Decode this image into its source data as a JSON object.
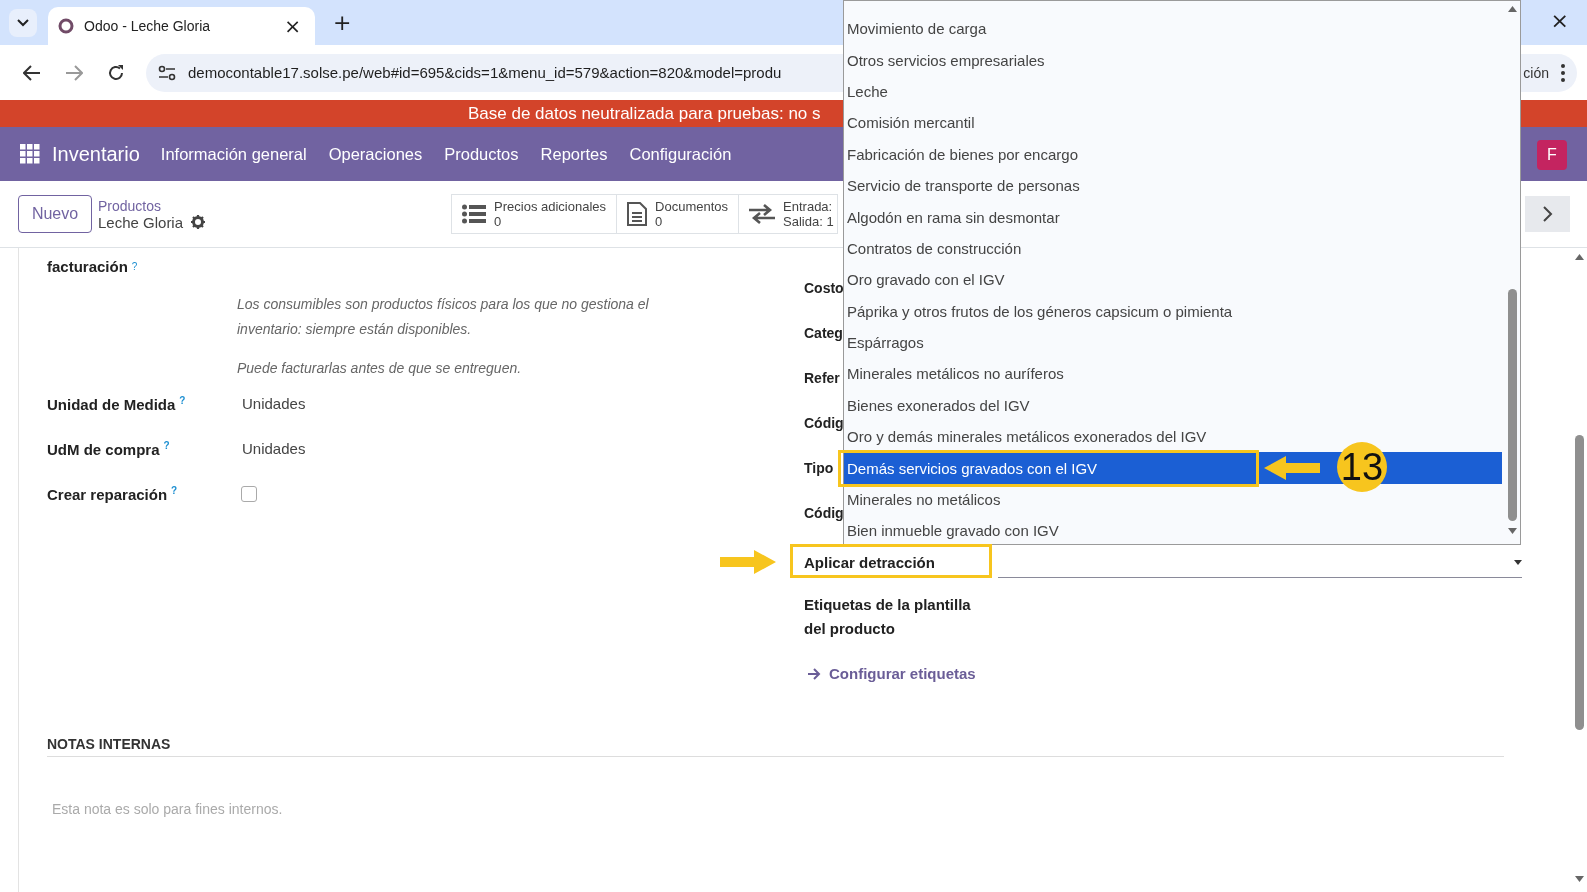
{
  "browser": {
    "tab_title": "Odoo - Leche Gloria",
    "tab_close": "×",
    "new_tab": "+",
    "window_close": "×",
    "url": "democontable17.solse.pe/web#id=695&cids=1&menu_id=579&action=820&model=produ",
    "url_end": "ción"
  },
  "banner": "Base de datos neutralizada para pruebas: no s",
  "navbar": {
    "app": "Inventario",
    "menu": [
      "Información general",
      "Operaciones",
      "Productos",
      "Reportes",
      "Configuración"
    ],
    "avatar": "F"
  },
  "control_panel": {
    "new_button": "Nuevo",
    "breadcrumb_parent": "Productos",
    "record": "Leche Gloria",
    "stat_buttons": [
      {
        "kind": "list",
        "label": "Precios adicionales",
        "value": "0"
      },
      {
        "kind": "document",
        "label": "Documentos",
        "value": "0"
      },
      {
        "kind": "transfer",
        "label": "Entrada:",
        "value": "Salida: 1"
      }
    ]
  },
  "form": {
    "invoicing_label": "facturación",
    "invoicing_help": "?",
    "notes": [
      "Los consumibles son productos físicos para los que no gestiona el inventario: siempre están disponibles.",
      "Puede facturarlas antes de que se entreguen."
    ],
    "left_fields": [
      {
        "kind": "value",
        "label": "Unidad de Medida",
        "help": "?",
        "value": "Unidades"
      },
      {
        "kind": "value",
        "label": "UdM de compra",
        "help": "?",
        "value": "Unidades"
      },
      {
        "kind": "checkbox",
        "label": "Crear reparación",
        "help": "?",
        "checked": false
      }
    ],
    "right_labels": [
      "Costo",
      "Categ",
      "Refer",
      "Códig",
      "Tipo",
      "Códig"
    ],
    "detraction_label": "Aplicar detracción",
    "tags_label": "Etiquetas de la plantilla del producto",
    "configure_link": "Configurar etiquetas",
    "notes_title": "NOTAS INTERNAS",
    "notes_placeholder": "Esta nota es solo para fines internos."
  },
  "dropdown": {
    "options": [
      {
        "label": "Movimiento de carga",
        "selected": false
      },
      {
        "label": "Otros servicios empresariales",
        "selected": false
      },
      {
        "label": "Leche",
        "selected": false
      },
      {
        "label": "Comisión mercantil",
        "selected": false
      },
      {
        "label": "Fabricación de bienes por encargo",
        "selected": false
      },
      {
        "label": "Servicio de transporte de personas",
        "selected": false
      },
      {
        "label": "Algodón en rama sin desmontar",
        "selected": false
      },
      {
        "label": "Contratos de construcción",
        "selected": false
      },
      {
        "label": "Oro gravado con el IGV",
        "selected": false
      },
      {
        "label": "Páprika y otros frutos de los géneros capsicum o pimienta",
        "selected": false
      },
      {
        "label": "Espárragos",
        "selected": false
      },
      {
        "label": "Minerales metálicos no auríferos",
        "selected": false
      },
      {
        "label": "Bienes exonerados del IGV",
        "selected": false
      },
      {
        "label": "Oro y demás minerales metálicos exonerados del IGV",
        "selected": false
      },
      {
        "label": "Demás servicios gravados con el IGV",
        "selected": true
      },
      {
        "label": "Minerales no metálicos",
        "selected": false
      },
      {
        "label": "Bien inmueble gravado con IGV",
        "selected": false
      }
    ]
  },
  "annotation": {
    "step": "13"
  }
}
